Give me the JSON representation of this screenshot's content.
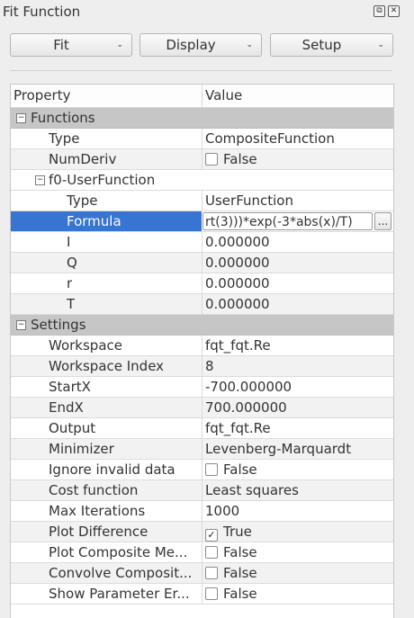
{
  "window": {
    "title": "Fit Function",
    "float_icon": "⧉",
    "close_icon": "✕"
  },
  "toolbar": {
    "fit_label": "Fit",
    "display_label": "Display",
    "setup_label": "Setup",
    "chevron": "⌄"
  },
  "table": {
    "header_property": "Property",
    "header_value": "Value"
  },
  "groups": {
    "functions": "Functions",
    "settings": "Settings",
    "f0": "f0-UserFunction"
  },
  "rows": {
    "type": {
      "label": "Type",
      "value": "CompositeFunction"
    },
    "numderiv": {
      "label": "NumDeriv",
      "value": "False",
      "checked": false
    },
    "f0_type": {
      "label": "Type",
      "value": "UserFunction"
    },
    "formula": {
      "label": "Formula",
      "value": "rt(3)))*exp(-3*abs(x)/T)",
      "button": "..."
    },
    "I": {
      "label": "I",
      "value": "0.000000"
    },
    "Q": {
      "label": "Q",
      "value": "0.000000"
    },
    "r": {
      "label": "r",
      "value": "0.000000"
    },
    "T": {
      "label": "T",
      "value": "0.000000"
    }
  },
  "settings": [
    {
      "label": "Workspace",
      "value": "fqt_fqt.Re",
      "kind": "text"
    },
    {
      "label": "Workspace Index",
      "value": "8",
      "kind": "text"
    },
    {
      "label": "StartX",
      "value": "-700.000000",
      "kind": "text"
    },
    {
      "label": "EndX",
      "value": "700.000000",
      "kind": "text"
    },
    {
      "label": "Output",
      "value": "fqt_fqt.Re",
      "kind": "text"
    },
    {
      "label": "Minimizer",
      "value": "Levenberg-Marquardt",
      "kind": "text"
    },
    {
      "label": "Ignore invalid data",
      "value": "False",
      "kind": "check",
      "checked": false
    },
    {
      "label": "Cost function",
      "value": "Least squares",
      "kind": "text"
    },
    {
      "label": "Max Iterations",
      "value": "1000",
      "kind": "text"
    },
    {
      "label": "Plot Difference",
      "value": "True",
      "kind": "check",
      "checked": true
    },
    {
      "label": "Plot Composite Me...",
      "value": "False",
      "kind": "check",
      "checked": false
    },
    {
      "label": "Convolve Composit...",
      "value": "False",
      "kind": "check",
      "checked": false
    },
    {
      "label": "Show Parameter Er...",
      "value": "False",
      "kind": "check",
      "checked": false
    }
  ],
  "colors": {
    "selection": "#3874d2",
    "group_bg": "#c6c6c6"
  }
}
